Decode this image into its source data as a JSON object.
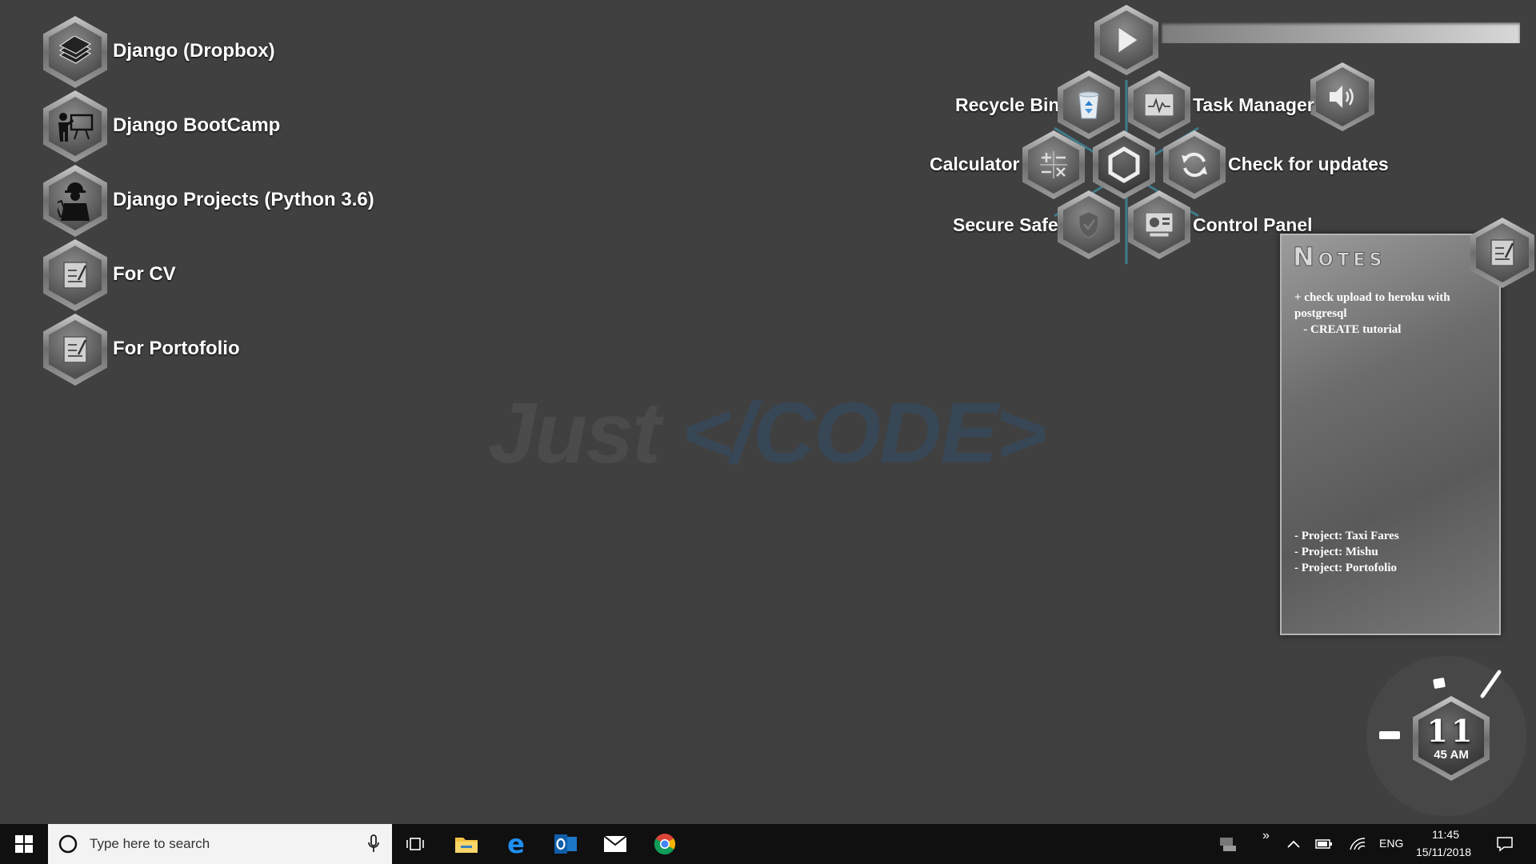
{
  "shortcuts": [
    {
      "label": "Django (Dropbox)",
      "icon": "stack-of-books-icon"
    },
    {
      "label": "Django BootCamp",
      "icon": "presenter-icon"
    },
    {
      "label": "Django Projects (Python 3.6)",
      "icon": "engineer-icon"
    },
    {
      "label": "For CV",
      "icon": "notepad-icon"
    },
    {
      "label": "For Portofolio",
      "icon": "notepad-icon"
    }
  ],
  "watermark": {
    "just": "Just",
    "code": "</CODE>"
  },
  "launcher": {
    "recycle_bin": "Recycle Bin",
    "task_manager": "Task Manager",
    "calculator": "Calculator",
    "check_updates": "Check for updates",
    "secure_safe": "Secure Safe",
    "control_panel": "Control Panel"
  },
  "media": {
    "progress": 0.0
  },
  "notes": {
    "title": "Notes",
    "line1": "+ check upload to heroku with postgresql",
    "line2": "   - CREATE tutorial",
    "line3": "- Project: Taxi Fares",
    "line4": "- Project: Mishu",
    "line5": "- Project: Portofolio"
  },
  "clock": {
    "hour": "11",
    "minute_ampm": "45 AM"
  },
  "taskbar": {
    "search_placeholder": "Type here to search",
    "language": "ENG",
    "time": "11:45",
    "date": "15/11/2018",
    "overflow": "»"
  },
  "colors": {
    "desktop": "#404040",
    "watermark_code": "#384756",
    "teal_accent": "#3f8fa3"
  }
}
